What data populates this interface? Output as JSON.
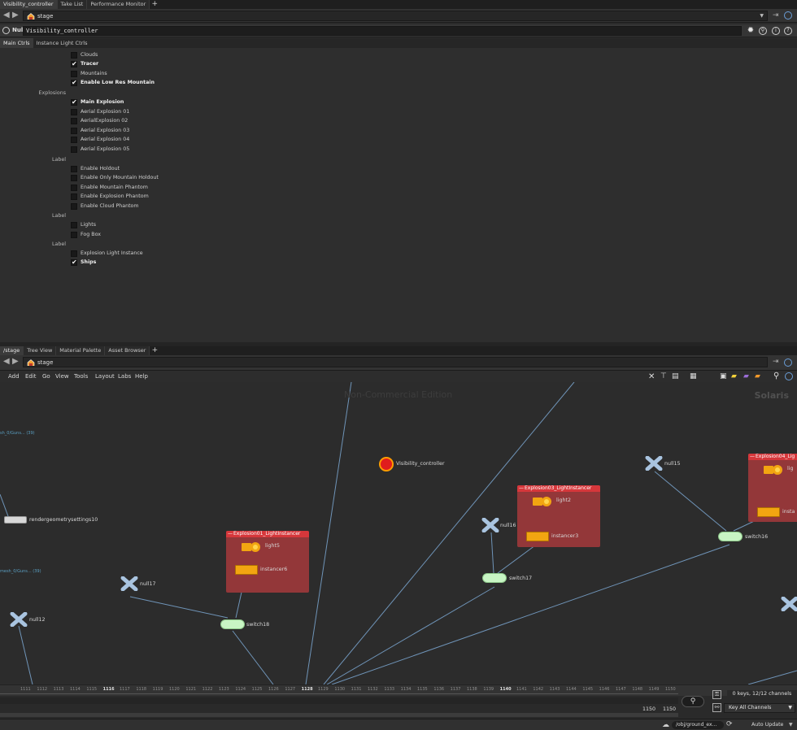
{
  "top_tabs": [
    "Visibility_controller",
    "Take List",
    "Performance Monitor"
  ],
  "top_path": "stage",
  "parm_header": {
    "type": "Null",
    "name": "Visibility_controller"
  },
  "parm_tabs": [
    "Main Ctrls",
    "Instance Light Ctrls"
  ],
  "params": [
    {
      "label": "Clouds",
      "checked": false
    },
    {
      "label": "Tracer",
      "checked": true
    },
    {
      "label": "Mountains",
      "checked": false
    },
    {
      "label": "Enable Low Res Mountain",
      "checked": true
    },
    {
      "group": "Explosions"
    },
    {
      "label": "Main Explosion",
      "checked": true
    },
    {
      "label": "Aerial Explosion 01",
      "checked": false
    },
    {
      "label": "AerialExplosion 02",
      "checked": false
    },
    {
      "label": "Aerial Explosion 03",
      "checked": false
    },
    {
      "label": "Aerial Explosion 04",
      "checked": false
    },
    {
      "label": "Aerial Explosion 05",
      "checked": false
    },
    {
      "group": "Label"
    },
    {
      "label": "Enable Holdout",
      "checked": false
    },
    {
      "label": "Enable Only Mountain Holdout",
      "checked": false
    },
    {
      "label": "Enable Mountain Phantom",
      "checked": false
    },
    {
      "label": "Enable Explosion Phantom",
      "checked": false
    },
    {
      "label": "Enable Cloud Phantom",
      "checked": false
    },
    {
      "group": "Label"
    },
    {
      "label": "Lights",
      "checked": false
    },
    {
      "label": "Fog Box",
      "checked": false
    },
    {
      "group": "Label"
    },
    {
      "label": "Explosion Light Instance",
      "checked": false
    },
    {
      "label": "Ships",
      "checked": true
    }
  ],
  "net_tabs": [
    "/stage",
    "Tree View",
    "Material Palette",
    "Asset Browser"
  ],
  "net_path": "stage",
  "menu": [
    "Add",
    "Edit",
    "Go",
    "View",
    "Tools",
    "Layout",
    "Labs",
    "Help"
  ],
  "watermark": "Non-Commercial Edition",
  "context_label": "Solaris",
  "network": {
    "vc": "Visibility_controller",
    "null15": "null15",
    "null16": "null16",
    "null17": "null17",
    "null12": "null12",
    "switch16": "switch16",
    "switch17": "switch17",
    "switch18": "switch18",
    "box1": "Explosion01_LightInstancer",
    "box3": "Explosion03_LightInstancer",
    "box4": "Explosion04_Lig",
    "light5": "light5",
    "light2": "light2",
    "light_partial": "lig",
    "instancer6": "instancer6",
    "instancer3": "instancer3",
    "instancer_partial": "insta",
    "rgs": "rendergeometrysettings10",
    "side1": "sh_0/Guns... (39)",
    "side2": "mesh_0/Guns... (39)"
  },
  "timeline": {
    "ticks": [
      "1111",
      "1112",
      "1113",
      "1114",
      "1115",
      "1116",
      "1117",
      "1118",
      "1119",
      "1120",
      "1121",
      "1122",
      "1123",
      "1124",
      "1125",
      "1126",
      "1127",
      "1128",
      "1129",
      "1130",
      "1131",
      "1132",
      "1133",
      "1134",
      "1135",
      "1136",
      "1137",
      "1138",
      "1139",
      "1140",
      "1141",
      "1142",
      "1143",
      "1144",
      "1145",
      "1146",
      "1147",
      "1148",
      "1149",
      "1150"
    ],
    "range_start": "1150",
    "range_end": "1150",
    "keys_info": "0 keys, 12/12 channels",
    "key_all": "Key All Channels"
  },
  "status": {
    "path": "/obj/ground_ex...",
    "auto_update": "Auto Update"
  }
}
